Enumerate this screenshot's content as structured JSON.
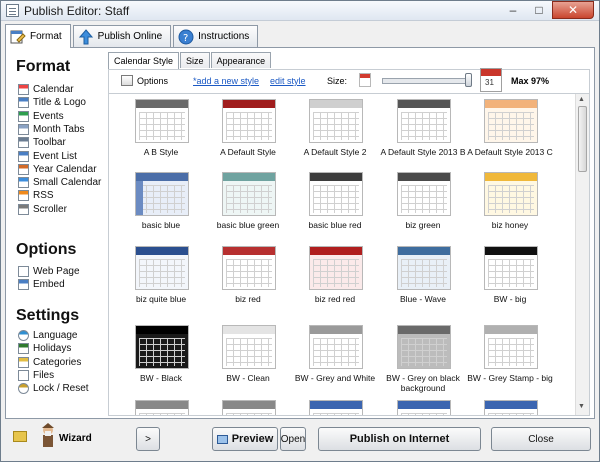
{
  "window": {
    "title": "Publish Editor: Staff",
    "controls": [
      "–",
      "□",
      "✕"
    ]
  },
  "tabs": [
    {
      "label": "Format",
      "icon": "format-icon"
    },
    {
      "label": "Publish Online",
      "icon": "upload-arrow-icon"
    },
    {
      "label": "Instructions",
      "icon": "help-icon"
    }
  ],
  "sidebar": {
    "format_title": "Format",
    "format_items": [
      {
        "label": "Calendar",
        "icon": "calendar-icon"
      },
      {
        "label": "Title & Logo",
        "icon": "title-logo-icon"
      },
      {
        "label": "Events",
        "icon": "events-icon"
      },
      {
        "label": "Month Tabs",
        "icon": "month-tabs-icon"
      },
      {
        "label": "Toolbar",
        "icon": "toolbar-icon"
      },
      {
        "label": "Event List",
        "icon": "event-list-icon"
      },
      {
        "label": "Year Calendar",
        "icon": "year-calendar-icon"
      },
      {
        "label": "Small Calendar",
        "icon": "small-calendar-icon"
      },
      {
        "label": "RSS",
        "icon": "rss-icon"
      },
      {
        "label": "Scroller",
        "icon": "scroller-icon"
      }
    ],
    "options_title": "Options",
    "options_items": [
      {
        "label": "Web Page",
        "icon": "web-page-icon"
      },
      {
        "label": "Embed",
        "icon": "embed-icon"
      }
    ],
    "settings_title": "Settings",
    "settings_items": [
      {
        "label": "Language",
        "icon": "globe-icon"
      },
      {
        "label": "Holidays",
        "icon": "tree-icon"
      },
      {
        "label": "Categories",
        "icon": "folder-icon"
      },
      {
        "label": "Files",
        "icon": "files-icon"
      },
      {
        "label": "Lock / Reset",
        "icon": "lock-icon"
      }
    ]
  },
  "subtabs": [
    "Calendar Style",
    "Size",
    "Appearance"
  ],
  "toolbar": {
    "options_label": "Options",
    "add_style": "*add a new style",
    "edit_style": "edit style",
    "size_label": "Size:",
    "max_label": "Max 97%",
    "size_percent": 97
  },
  "styles": [
    {
      "label": "A B Style",
      "header": "#6a6a6a",
      "accent": "#ffffff"
    },
    {
      "label": "A Default Style",
      "header": "#a01d1d",
      "accent": "#ffffff"
    },
    {
      "label": "A Default Style 2",
      "header": "#cfcfcf",
      "accent": "#ffffff"
    },
    {
      "label": "A Default Style 2013 B",
      "header": "#555555",
      "accent": "#ffffff"
    },
    {
      "label": "A Default Style 2013 C",
      "header": "#f2b27a",
      "accent": "#fff6ea"
    },
    {
      "label": "basic blue",
      "header": "#4b6ea8",
      "accent": "#e8eef8"
    },
    {
      "label": "basic blue green",
      "header": "#6fa3a0",
      "accent": "#eef6f5"
    },
    {
      "label": "basic blue red",
      "header": "#3d3d3d",
      "accent": "#ffffff"
    },
    {
      "label": "biz green",
      "header": "#4a4a4a",
      "accent": "#ffffff"
    },
    {
      "label": "biz honey",
      "header": "#f0b83a",
      "accent": "#fff8e2"
    },
    {
      "label": "biz quite blue",
      "header": "#2b4f8f",
      "accent": "#f3f6fb"
    },
    {
      "label": "biz red",
      "header": "#b73030",
      "accent": "#ffffff"
    },
    {
      "label": "biz red red",
      "header": "#b01e1e",
      "accent": "#fbeaea"
    },
    {
      "label": "Blue - Wave",
      "header": "#3f6d9e",
      "accent": "#e9f0f7"
    },
    {
      "label": "BW - big",
      "header": "#111111",
      "accent": "#ffffff"
    },
    {
      "label": "BW - Black",
      "header": "#000000",
      "accent": "#1a1a1a"
    },
    {
      "label": "BW - Clean",
      "header": "#e4e4e4",
      "accent": "#ffffff"
    },
    {
      "label": "BW - Grey and White",
      "header": "#9a9a9a",
      "accent": "#ffffff"
    },
    {
      "label": "BW - Grey on black background",
      "header": "#6a6a6a",
      "accent": "#bcbcbc"
    },
    {
      "label": "BW - Grey Stamp - big",
      "header": "#b0b0b0",
      "accent": "#ffffff"
    },
    {
      "label": "",
      "header": "#888888",
      "accent": "#ffffff"
    },
    {
      "label": "",
      "header": "#888888",
      "accent": "#ffffff"
    },
    {
      "label": "",
      "header": "#3b65b0",
      "accent": "#ffffff"
    },
    {
      "label": "",
      "header": "#3b65b0",
      "accent": "#ffffff"
    },
    {
      "label": "",
      "header": "#3b65b0",
      "accent": "#ffffff"
    }
  ],
  "bottom": {
    "wizard": "Wizard",
    "next": ">",
    "preview": "Preview",
    "open": "Open",
    "publish": "Publish on Internet",
    "close": "Close"
  }
}
